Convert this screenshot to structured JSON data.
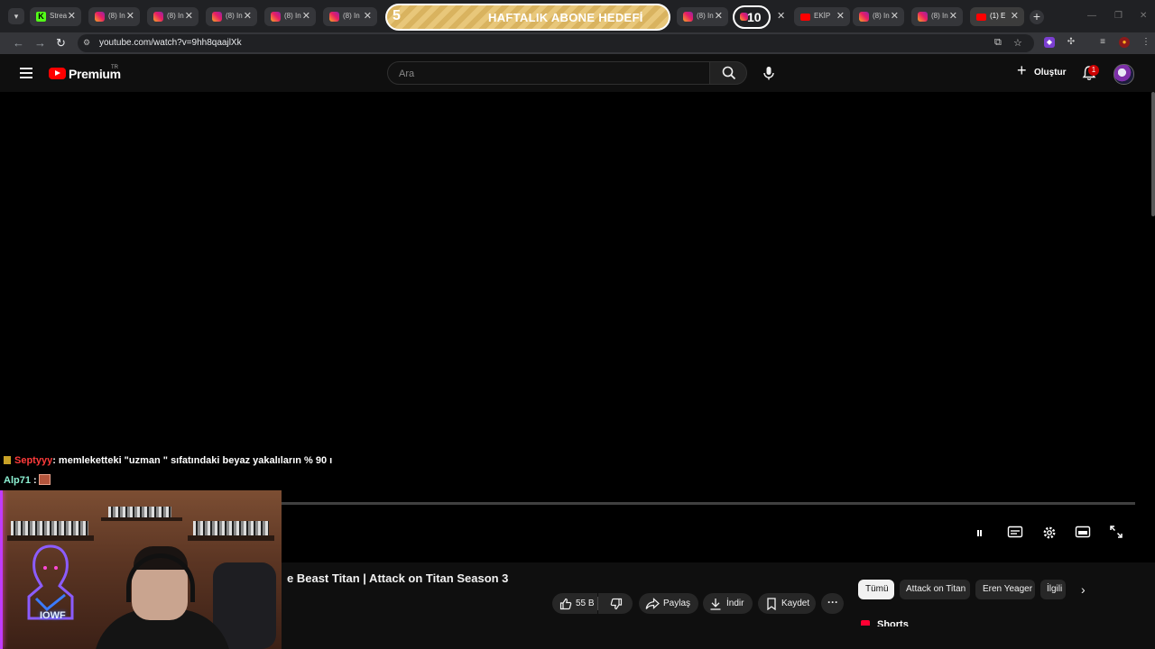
{
  "browser": {
    "tabs": [
      {
        "label": "Strea",
        "favicon": "kick"
      },
      {
        "label": "(8) In",
        "favicon": "instagram"
      },
      {
        "label": "(8) In",
        "favicon": "instagram"
      },
      {
        "label": "(8) In",
        "favicon": "instagram"
      },
      {
        "label": "(8) In",
        "favicon": "instagram"
      },
      {
        "label": "(8) In",
        "favicon": "instagram"
      },
      {
        "label": "(8) In",
        "favicon": "instagram"
      },
      {
        "label": "EKİP",
        "favicon": "youtube"
      },
      {
        "label": "(8) In",
        "favicon": "instagram"
      },
      {
        "label": "(8) In",
        "favicon": "instagram"
      },
      {
        "label": "(1) E",
        "favicon": "youtube"
      }
    ],
    "url": "youtube.com/watch?v=9hh8qaajlXk"
  },
  "overlay": {
    "goal_current": "5",
    "goal_text": "HAFTALIK ABONE HEDEFİ",
    "goal_target": "10"
  },
  "youtube": {
    "brand": "Premium",
    "brand_region": "TR",
    "search_placeholder": "Ara",
    "create_label": "Oluştur",
    "notification_count": "1"
  },
  "chat": [
    {
      "user": "Septyyy",
      "message": ": memleketteki \"uzman \" sıfatındaki beyaz yakalıların % 90 ı"
    },
    {
      "user": "Alp71",
      "message": " :"
    }
  ],
  "player": {
    "progress": 0.0
  },
  "video": {
    "title": "e Beast Titan | Attack on Titan Season 3",
    "like_count": "55 B",
    "share_label": "Paylaş",
    "download_label": "İndir",
    "save_label": "Kaydet"
  },
  "chips": [
    "Tümü",
    "Attack on Titan",
    "Eren Yeager",
    "İlgili"
  ],
  "shorts_label": "Shorts",
  "webcam": {
    "neon_sign": "IOWF"
  },
  "colors": {
    "accent": "#ff0000",
    "background": "#0f0f0f",
    "chat_user_1": "#ff3b3b",
    "chat_user_2": "#8cf0d2"
  }
}
